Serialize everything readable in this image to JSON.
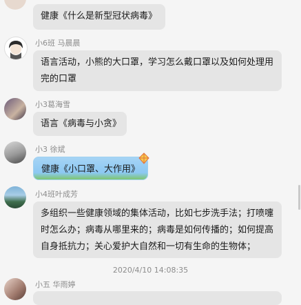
{
  "messages": [
    {
      "sender": "",
      "text": "健康《什么是新型冠状病毒》"
    },
    {
      "sender": "小6班 马晨晨",
      "text": "语言活动，小熊的大口罩，学习怎么戴口罩以及如何处理用完的口罩"
    },
    {
      "sender": "小3葛海雪",
      "text": "语言《病毒与小贪》"
    },
    {
      "sender": "小3  徐斌",
      "text": "健康《小口罩、大作用》"
    },
    {
      "sender": "小4班叶成芳",
      "text": "多组织一些健康领域的集体活动，比如七步洗手法；打喷嚏时怎么办；病毒从哪里来的；病毒是如何传播的；如何提高自身抵抗力；关心爱护大自然和一切有生命的生物体；"
    },
    {
      "sender": "小五 华雨婷",
      "text": ""
    }
  ],
  "timestamp": "2020/4/10 14:08:35",
  "colors": {
    "bubble": "#e5e5e5",
    "bubble_highlight": "#a6d4f5",
    "meta_text": "#8c8c8c",
    "background": "#f5f5f5"
  }
}
